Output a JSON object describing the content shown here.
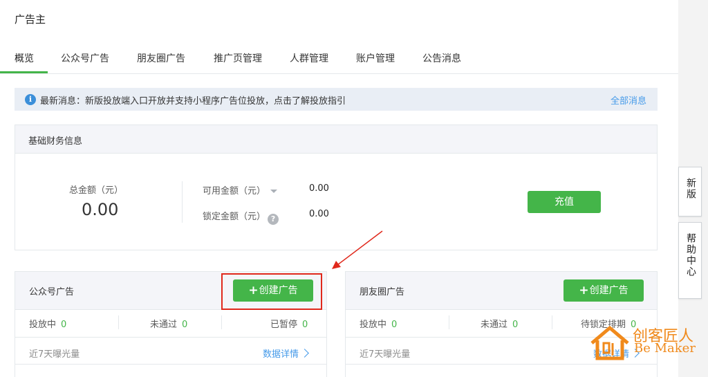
{
  "app": {
    "title": "广告主"
  },
  "tabs": [
    {
      "label": "概览",
      "active": true
    },
    {
      "label": "公众号广告"
    },
    {
      "label": "朋友圈广告"
    },
    {
      "label": "推广页管理"
    },
    {
      "label": "人群管理"
    },
    {
      "label": "账户管理"
    },
    {
      "label": "公告消息"
    }
  ],
  "notice": {
    "icon": "info-icon",
    "text": "最新消息：新版投放端入口开放并支持小程序广告位投放，点击了解投放指引",
    "link": "全部消息"
  },
  "finance": {
    "title": "基础财务信息",
    "total_label": "总金额（元）",
    "total_value": "0.00",
    "available_label": "可用金额（元）",
    "available_value": "0.00",
    "locked_label": "锁定金额（元）",
    "locked_value": "0.00",
    "help_glyph": "?",
    "recharge_label": "充值"
  },
  "panels": {
    "official": {
      "title": "公众号广告",
      "create_label": "创建广告",
      "stats": [
        {
          "label": "投放中",
          "value": "0"
        },
        {
          "label": "未通过",
          "value": "0"
        },
        {
          "label": "已暂停",
          "value": "0"
        }
      ],
      "exposure_label": "近7天曝光量",
      "detail_link": "数据详情"
    },
    "moments": {
      "title": "朋友圈广告",
      "create_label": "创建广告",
      "stats": [
        {
          "label": "投放中",
          "value": "0"
        },
        {
          "label": "未通过",
          "value": "0"
        },
        {
          "label": "待锁定排期",
          "value": "0"
        }
      ],
      "exposure_label": "近7天曝光量",
      "detail_link": "数据详情"
    }
  },
  "side_tabs": {
    "new_version": "新版",
    "help_center": "帮助中心"
  },
  "watermark": {
    "cn": "创客匠人",
    "en": "Be Maker"
  },
  "colors": {
    "accent_green": "#44b549",
    "link_blue": "#459ae9",
    "annotation_red": "#e0281b",
    "watermark_orange": "#f08a1c"
  }
}
